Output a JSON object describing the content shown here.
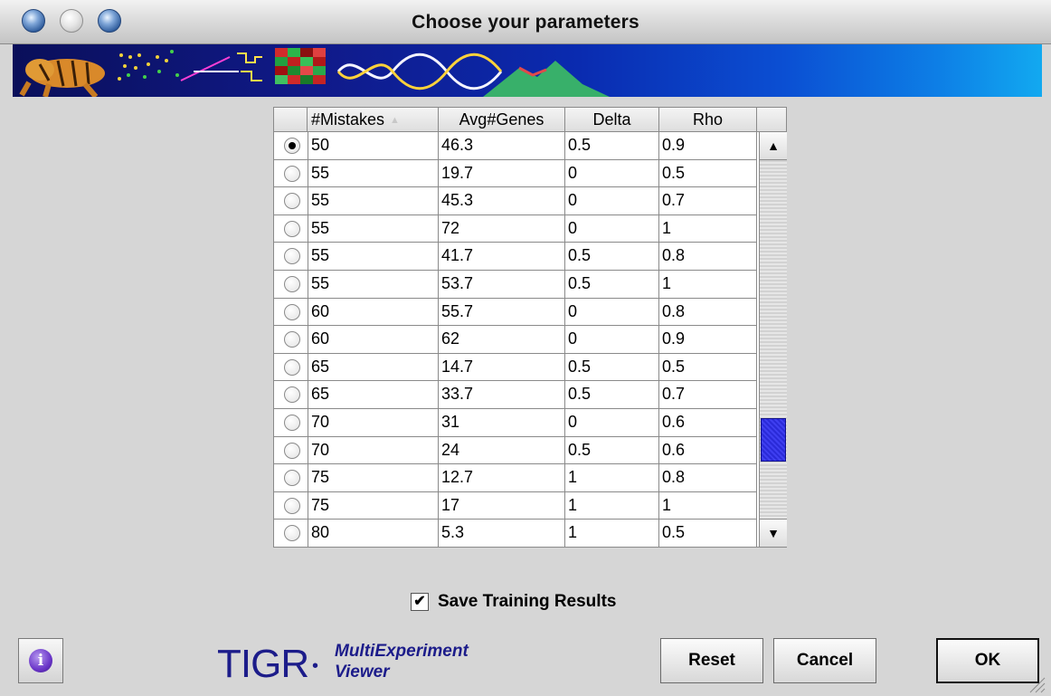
{
  "window": {
    "title": "Choose your parameters"
  },
  "table": {
    "columns": [
      "#Mistakes",
      "Avg#Genes",
      "Delta",
      "Rho"
    ],
    "sort_indicator": "▲",
    "rows": [
      {
        "selected": true,
        "mistakes": "50",
        "avg_genes": "46.3",
        "delta": "0.5",
        "rho": "0.9"
      },
      {
        "selected": false,
        "mistakes": "55",
        "avg_genes": "19.7",
        "delta": "0",
        "rho": "0.5"
      },
      {
        "selected": false,
        "mistakes": "55",
        "avg_genes": "45.3",
        "delta": "0",
        "rho": "0.7"
      },
      {
        "selected": false,
        "mistakes": "55",
        "avg_genes": "72",
        "delta": "0",
        "rho": "1"
      },
      {
        "selected": false,
        "mistakes": "55",
        "avg_genes": "41.7",
        "delta": "0.5",
        "rho": "0.8"
      },
      {
        "selected": false,
        "mistakes": "55",
        "avg_genes": "53.7",
        "delta": "0.5",
        "rho": "1"
      },
      {
        "selected": false,
        "mistakes": "60",
        "avg_genes": "55.7",
        "delta": "0",
        "rho": "0.8"
      },
      {
        "selected": false,
        "mistakes": "60",
        "avg_genes": "62",
        "delta": "0",
        "rho": "0.9"
      },
      {
        "selected": false,
        "mistakes": "65",
        "avg_genes": "14.7",
        "delta": "0.5",
        "rho": "0.5"
      },
      {
        "selected": false,
        "mistakes": "65",
        "avg_genes": "33.7",
        "delta": "0.5",
        "rho": "0.7"
      },
      {
        "selected": false,
        "mistakes": "70",
        "avg_genes": "31",
        "delta": "0",
        "rho": "0.6"
      },
      {
        "selected": false,
        "mistakes": "70",
        "avg_genes": "24",
        "delta": "0.5",
        "rho": "0.6"
      },
      {
        "selected": false,
        "mistakes": "75",
        "avg_genes": "12.7",
        "delta": "1",
        "rho": "0.8"
      },
      {
        "selected": false,
        "mistakes": "75",
        "avg_genes": "17",
        "delta": "1",
        "rho": "1"
      },
      {
        "selected": false,
        "mistakes": "80",
        "avg_genes": "5.3",
        "delta": "1",
        "rho": "0.5"
      }
    ],
    "scroll_position": 0.82
  },
  "options": {
    "save_training_results": {
      "label": "Save Training Results",
      "checked": true,
      "check_glyph": "✔"
    }
  },
  "logo": {
    "main": "TIGR",
    "separator": "•",
    "line1": "MultiExperiment",
    "line2": "Viewer"
  },
  "buttons": {
    "info_glyph": "i",
    "reset": "Reset",
    "cancel": "Cancel",
    "ok": "OK",
    "scroll_up_glyph": "▲",
    "scroll_down_glyph": "▼"
  },
  "colors": {
    "window_bg": "#d6d6d6",
    "accent_blue": "#1c1c8a",
    "scroll_thumb": "#2a2ad8",
    "banner_end": "#12a9f0"
  }
}
